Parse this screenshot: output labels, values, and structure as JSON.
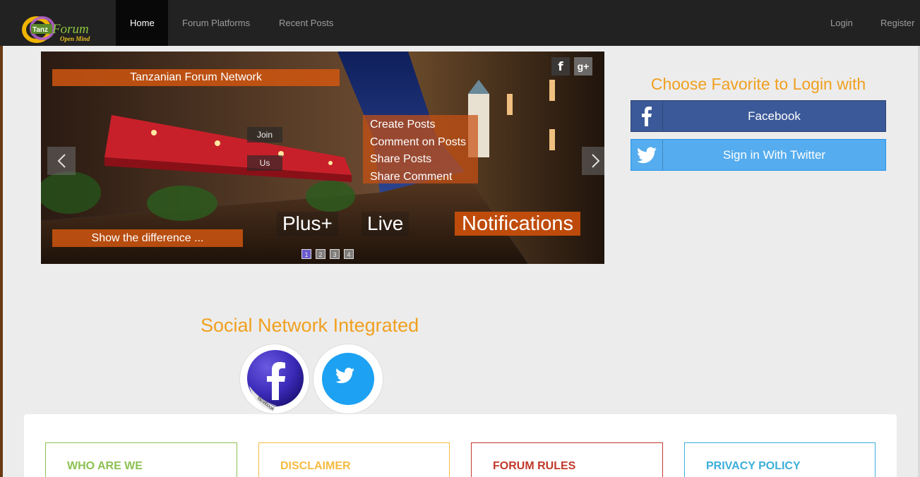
{
  "navbar": {
    "logo": {
      "main_text": "Tanz",
      "brand_text": "Forum",
      "tagline": "Open Mind"
    },
    "links": [
      {
        "label": "Home",
        "active": true
      },
      {
        "label": "Forum Platforms",
        "active": false
      },
      {
        "label": "Recent Posts",
        "active": false
      }
    ],
    "login_label": "Login",
    "register_label": "Register"
  },
  "slider": {
    "title_caption": "Tanzanian Forum Network",
    "join_label_1": "Join",
    "join_label_2": "Us",
    "features": [
      "Create Posts",
      "Comment on Posts",
      "Share Posts",
      "Share Comment"
    ],
    "big_words": [
      "Plus+",
      "Live",
      "Notifications"
    ],
    "bottom_caption": "Show the difference ...",
    "prev_icon": "chevron-left-icon",
    "next_icon": "chevron-right-icon",
    "social_icons": [
      "facebook-icon",
      "google-plus-icon"
    ],
    "social_fb_glyph": "f",
    "social_gp_glyph": "g+",
    "pager": [
      "1",
      "2",
      "3",
      "4"
    ],
    "active_page": "1"
  },
  "login_panel": {
    "title": "Choose Favorite to Login with",
    "facebook_label": "Facebook",
    "twitter_label": "Sign in With Twitter",
    "facebook_color": "#3b5998",
    "twitter_color": "#55acee"
  },
  "social_integrated": {
    "title": "Social Network Integrated",
    "facebook_sticker_text": "facebook"
  },
  "info_cards": [
    {
      "title": "WHO ARE WE",
      "color": "#8cc152"
    },
    {
      "title": "DISCLAIMER",
      "color": "#f6bb42"
    },
    {
      "title": "FORUM RULES",
      "color": "#c0392b"
    },
    {
      "title": "PRIVACY POLICY",
      "color": "#3bafda"
    }
  ],
  "accent_color": "#f0a020"
}
